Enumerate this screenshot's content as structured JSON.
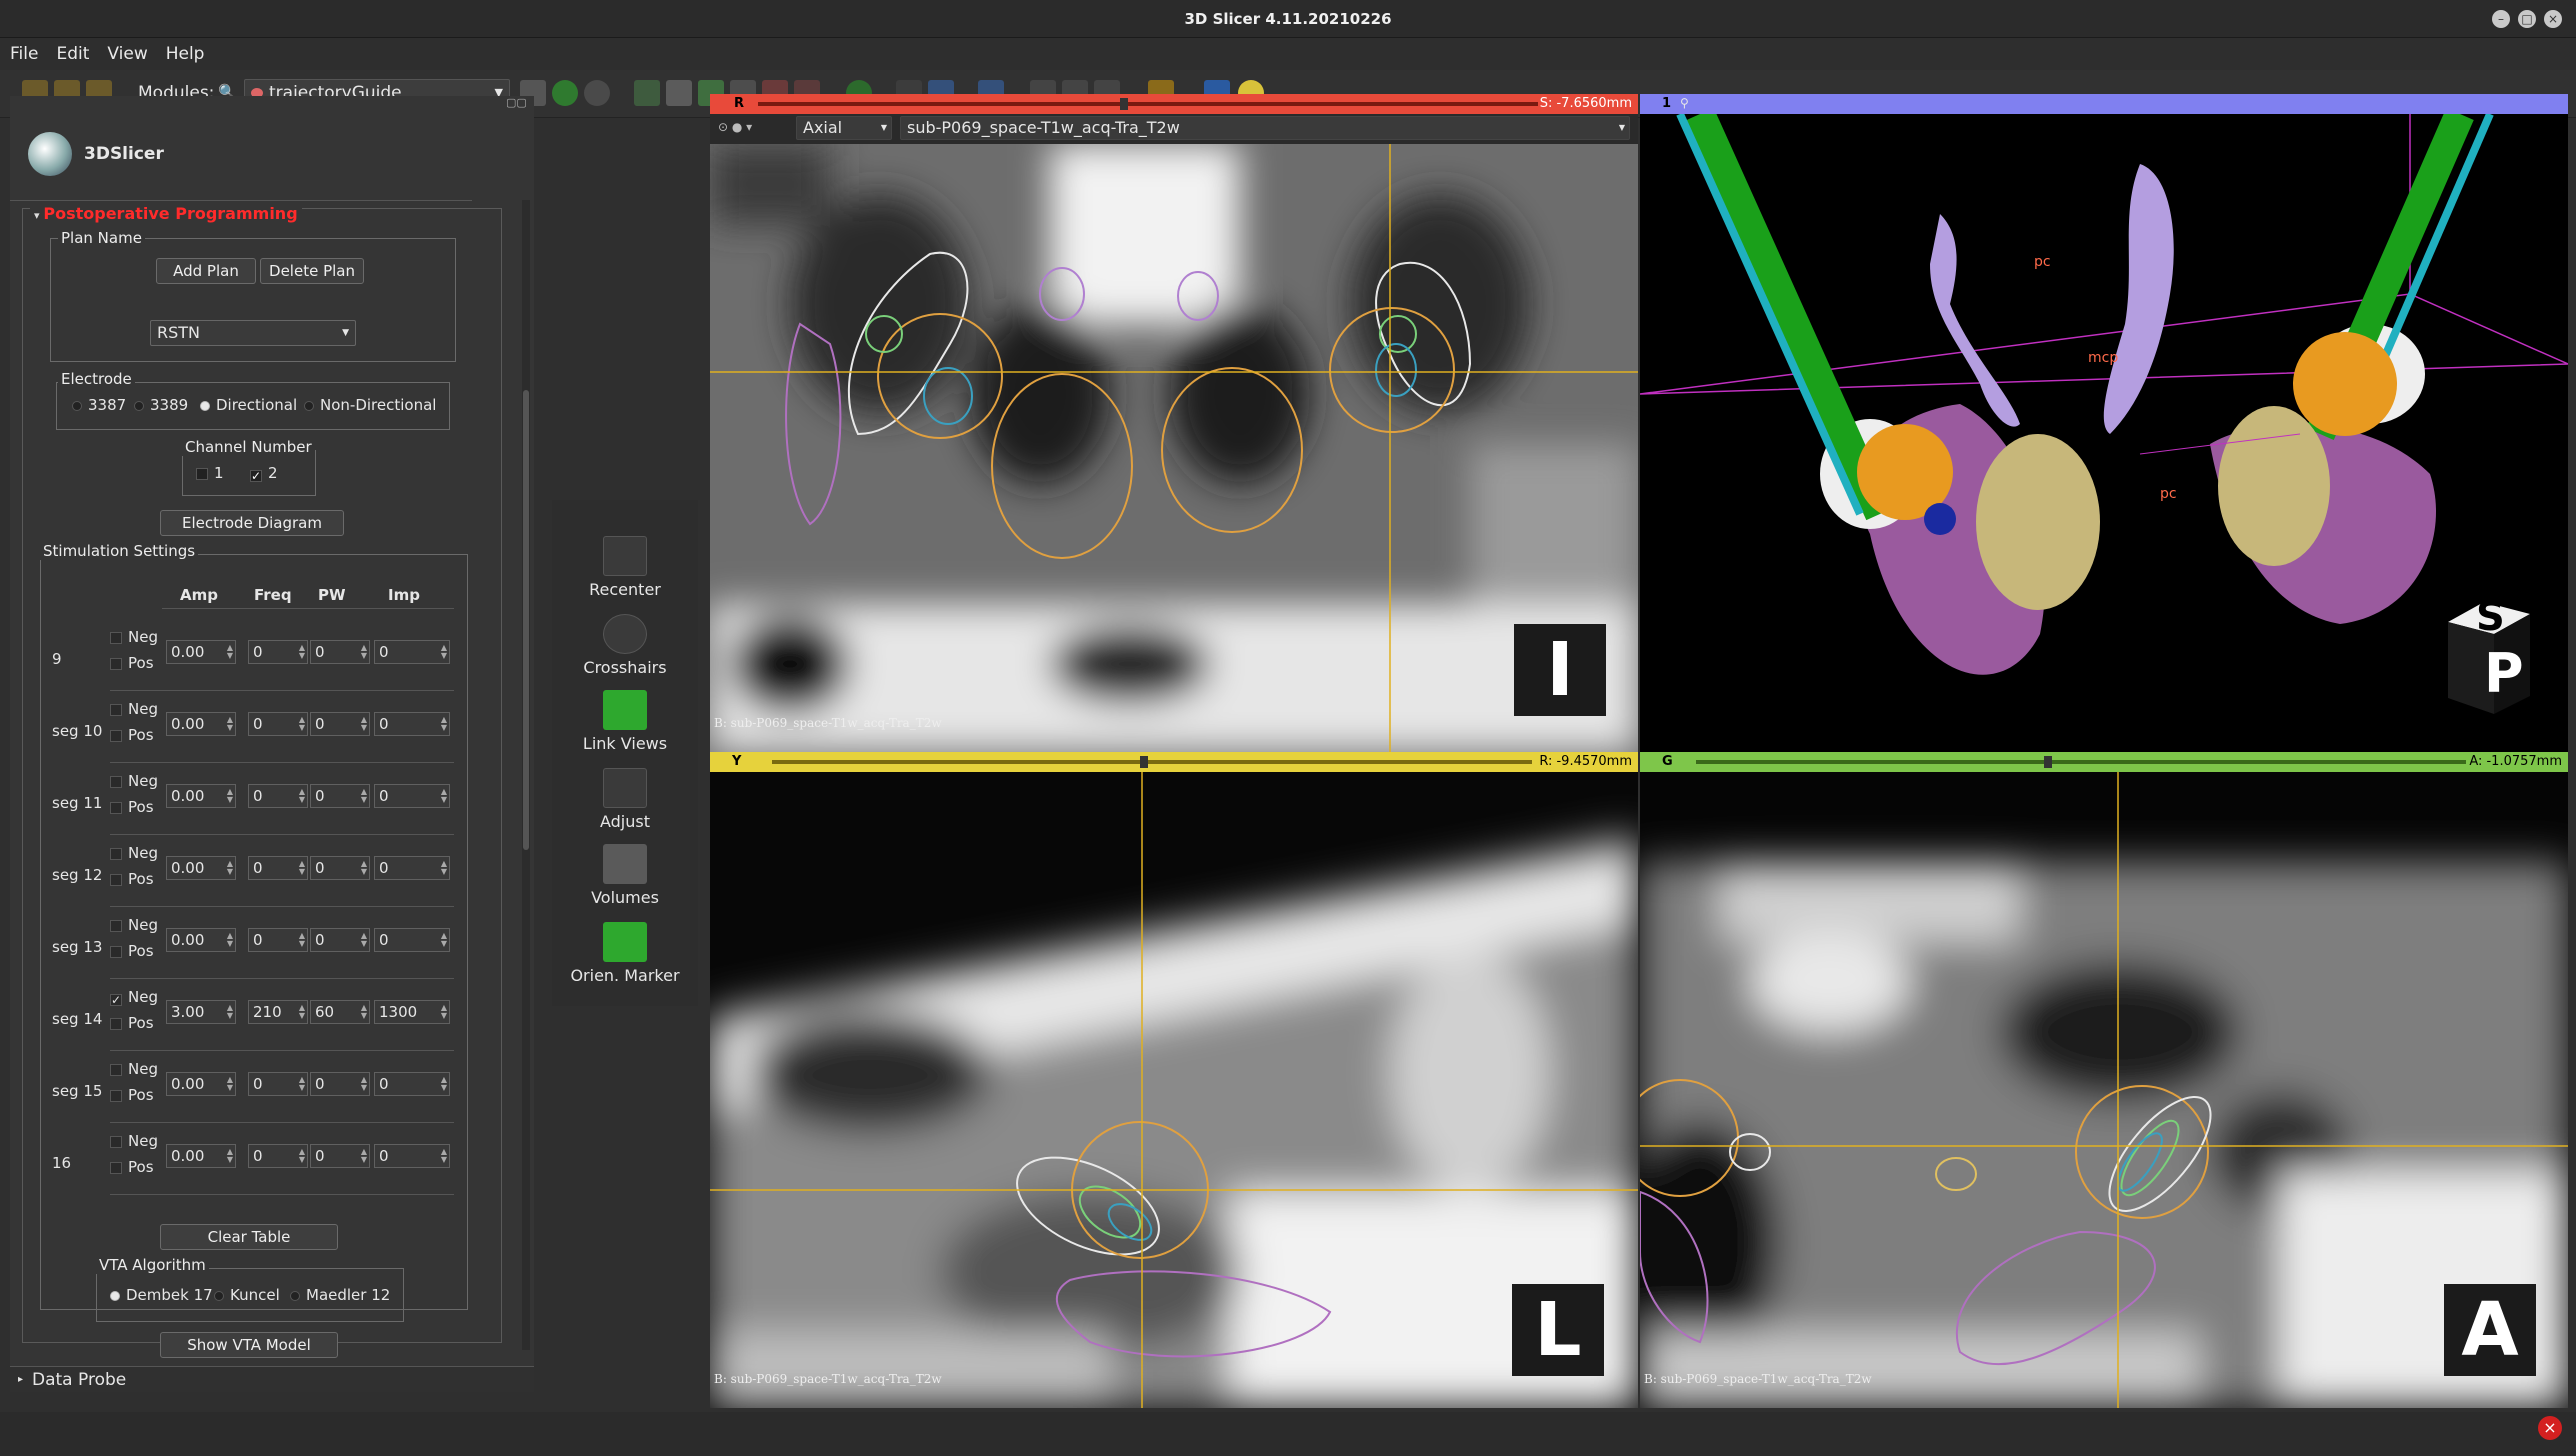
{
  "window": {
    "title": "3D Slicer 4.11.20210226"
  },
  "menu": [
    "File",
    "Edit",
    "View",
    "Help"
  ],
  "toolbar": {
    "modules_label": "Modules:",
    "module_selected": "trajectoryGuide"
  },
  "logo_text": "3DSlicer",
  "postop": {
    "title": "Postoperative Programming",
    "plan_name_label": "Plan Name",
    "add_plan": "Add Plan",
    "delete_plan": "Delete Plan",
    "plan_selected": "RSTN",
    "electrode_label": "Electrode",
    "electrode_options": [
      "3387",
      "3389",
      "Directional",
      "Non-Directional"
    ],
    "electrode_selected": "Directional",
    "channel_label": "Channel Number",
    "channels": [
      {
        "label": "1",
        "checked": false
      },
      {
        "label": "2",
        "checked": true
      }
    ],
    "electrode_diagram": "Electrode Diagram",
    "stim_label": "Stimulation Settings",
    "stim_headers": [
      "Amp",
      "Freq",
      "PW",
      "Imp"
    ],
    "stim_rows": [
      {
        "label": "9",
        "neg": false,
        "pos": false,
        "amp": "0.00",
        "freq": "0",
        "pw": "0",
        "imp": "0"
      },
      {
        "label": "seg 10",
        "neg": false,
        "pos": false,
        "amp": "0.00",
        "freq": "0",
        "pw": "0",
        "imp": "0"
      },
      {
        "label": "seg 11",
        "neg": false,
        "pos": false,
        "amp": "0.00",
        "freq": "0",
        "pw": "0",
        "imp": "0"
      },
      {
        "label": "seg 12",
        "neg": false,
        "pos": false,
        "amp": "0.00",
        "freq": "0",
        "pw": "0",
        "imp": "0"
      },
      {
        "label": "seg 13",
        "neg": false,
        "pos": false,
        "amp": "0.00",
        "freq": "0",
        "pw": "0",
        "imp": "0"
      },
      {
        "label": "seg 14",
        "neg": true,
        "pos": false,
        "amp": "3.00",
        "freq": "210",
        "pw": "60",
        "imp": "1300"
      },
      {
        "label": "seg 15",
        "neg": false,
        "pos": false,
        "amp": "0.00",
        "freq": "0",
        "pw": "0",
        "imp": "0"
      },
      {
        "label": "16",
        "neg": false,
        "pos": false,
        "amp": "0.00",
        "freq": "0",
        "pw": "0",
        "imp": "0"
      }
    ],
    "neg_label": "Neg",
    "pos_label": "Pos",
    "clear_table": "Clear Table",
    "vta_label": "VTA Algorithm",
    "vta_options": [
      "Dembek 17",
      "Kuncel",
      "Maedler 12"
    ],
    "vta_selected": "Dembek 17",
    "show_vta": "Show VTA Model"
  },
  "data_probe": "Data Probe",
  "side_tools": [
    "Recenter",
    "Crosshairs",
    "Link Views",
    "Adjust",
    "Volumes",
    "Orien. Marker"
  ],
  "views": {
    "red": {
      "letter": "R",
      "offset": "S: -7.6560mm",
      "orientation": "Axial",
      "volume": "sub-P069_space-T1w_acq-Tra_T2w",
      "bg": "B: sub-P069_space-T1w_acq-Tra_T2w",
      "marker": "I"
    },
    "three_d": {
      "letter": "1",
      "labels": [
        "pc",
        "mcp",
        "pc"
      ],
      "cube_top": "S",
      "cube_front": "P"
    },
    "yellow": {
      "letter": "Y",
      "offset": "R: -9.4570mm",
      "bg": "B: sub-P069_space-T1w_acq-Tra_T2w",
      "marker": "L"
    },
    "green": {
      "letter": "G",
      "offset": "A: -1.0757mm",
      "bg": "B: sub-P069_space-T1w_acq-Tra_T2w",
      "marker": "A"
    }
  },
  "colors": {
    "red": "#e84a3a",
    "yellow": "#e6d23c",
    "green": "#7ec64a",
    "blue3d": "#8080f0",
    "accent": "#ff2b2b"
  }
}
